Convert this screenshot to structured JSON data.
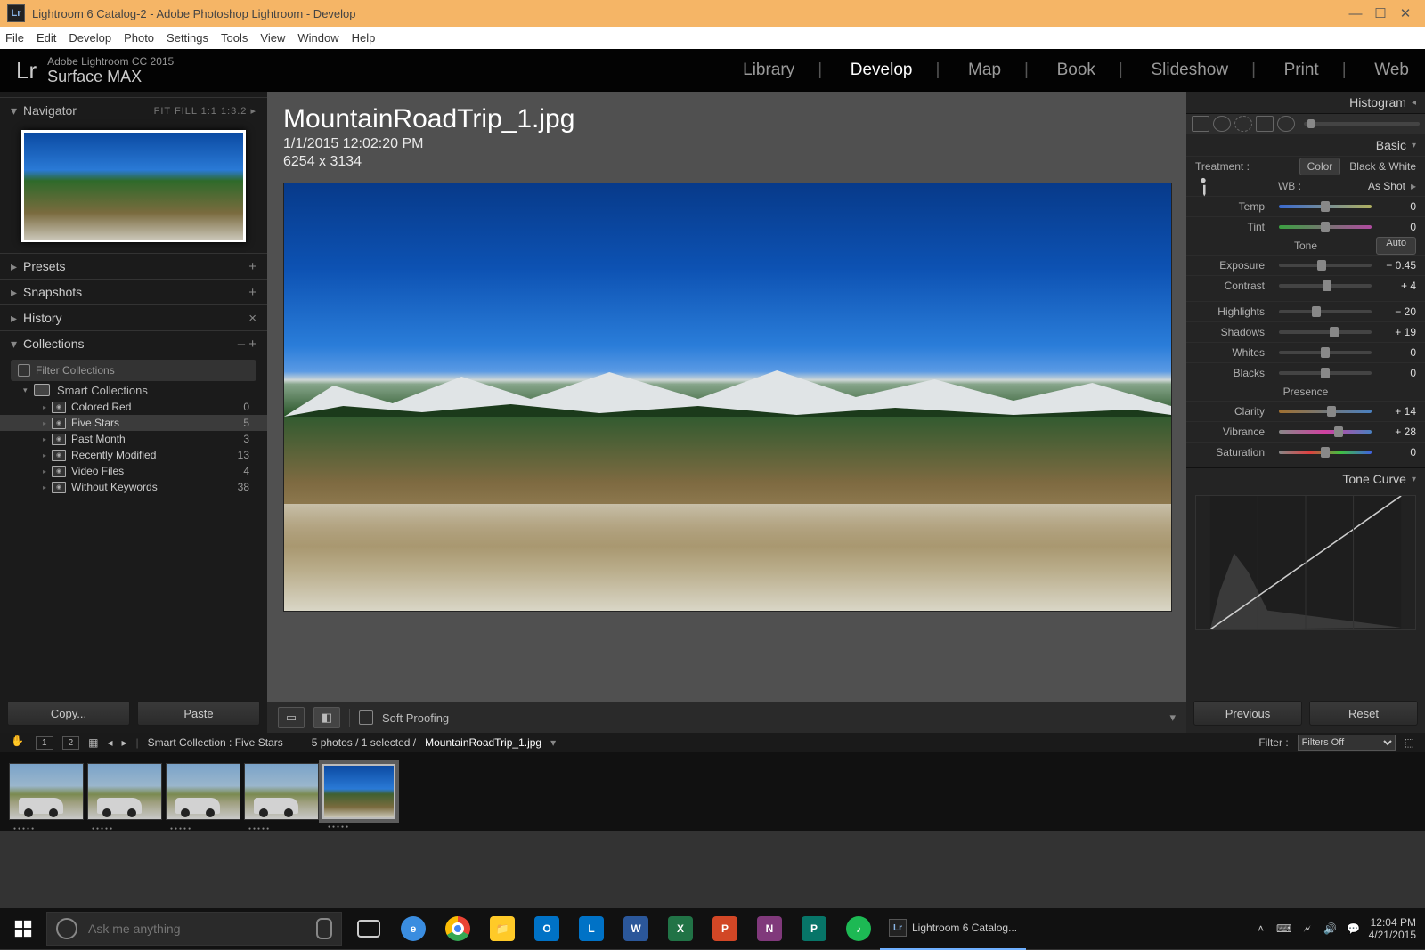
{
  "window": {
    "title": "Lightroom 6 Catalog-2 - Adobe Photoshop Lightroom - Develop"
  },
  "menubar": [
    "File",
    "Edit",
    "Develop",
    "Photo",
    "Settings",
    "Tools",
    "View",
    "Window",
    "Help"
  ],
  "brand": {
    "line1": "Adobe Lightroom CC 2015",
    "line2": "Surface MAX"
  },
  "modules": [
    "Library",
    "Develop",
    "Map",
    "Book",
    "Slideshow",
    "Print",
    "Web"
  ],
  "modules_active": "Develop",
  "left": {
    "navigator": {
      "label": "Navigator",
      "opts": "FIT   FILL   1:1   1:3.2  ▸"
    },
    "sections": [
      {
        "label": "Presets",
        "tail": "+"
      },
      {
        "label": "Snapshots",
        "tail": "+"
      },
      {
        "label": "History",
        "tail": "×"
      },
      {
        "label": "Collections",
        "tail": "–   +"
      }
    ],
    "filter": "Filter Collections",
    "smart": {
      "label": "Smart Collections",
      "items": [
        {
          "name": "Colored Red",
          "count": 0
        },
        {
          "name": "Five Stars",
          "count": 5,
          "selected": true
        },
        {
          "name": "Past Month",
          "count": 3
        },
        {
          "name": "Recently Modified",
          "count": 13
        },
        {
          "name": "Video Files",
          "count": 4
        },
        {
          "name": "Without Keywords",
          "count": 38
        }
      ]
    },
    "copy": "Copy...",
    "paste": "Paste"
  },
  "image": {
    "filename": "MountainRoadTrip_1.jpg",
    "datetime": "1/1/2015 12:02:20 PM",
    "dimensions": "6254 x 3134"
  },
  "softproof": "Soft Proofing",
  "right": {
    "histogram": "Histogram",
    "basic": "Basic",
    "treatment": {
      "label": "Treatment :",
      "color": "Color",
      "bw": "Black & White"
    },
    "wb": {
      "label": "WB :",
      "value": "As Shot"
    },
    "tone": {
      "title": "Tone",
      "auto": "Auto"
    },
    "presence": "Presence",
    "sliders": {
      "temp": {
        "label": "Temp",
        "value": "0",
        "pos": 50
      },
      "tint": {
        "label": "Tint",
        "value": "0",
        "pos": 50
      },
      "exposure": {
        "label": "Exposure",
        "value": "− 0.45",
        "pos": 46
      },
      "contrast": {
        "label": "Contrast",
        "value": "+ 4",
        "pos": 52
      },
      "highlights": {
        "label": "Highlights",
        "value": "− 20",
        "pos": 40
      },
      "shadows": {
        "label": "Shadows",
        "value": "+ 19",
        "pos": 60
      },
      "whites": {
        "label": "Whites",
        "value": "0",
        "pos": 50
      },
      "blacks": {
        "label": "Blacks",
        "value": "0",
        "pos": 50
      },
      "clarity": {
        "label": "Clarity",
        "value": "+ 14",
        "pos": 57
      },
      "vibrance": {
        "label": "Vibrance",
        "value": "+ 28",
        "pos": 64
      },
      "saturation": {
        "label": "Saturation",
        "value": "0",
        "pos": 50
      }
    },
    "tonecurve": "Tone Curve",
    "previous": "Previous",
    "reset": "Reset"
  },
  "filmstrip": {
    "crumb_collection": "Smart Collection : Five Stars",
    "crumb_count": "5 photos / 1 selected /",
    "crumb_file": "MountainRoadTrip_1.jpg",
    "filter_label": "Filter :",
    "filter_value": "Filters Off"
  },
  "taskbar": {
    "search_placeholder": "Ask me anything",
    "app_label": "Lightroom 6 Catalog...",
    "time": "12:04 PM",
    "date": "4/21/2015"
  }
}
